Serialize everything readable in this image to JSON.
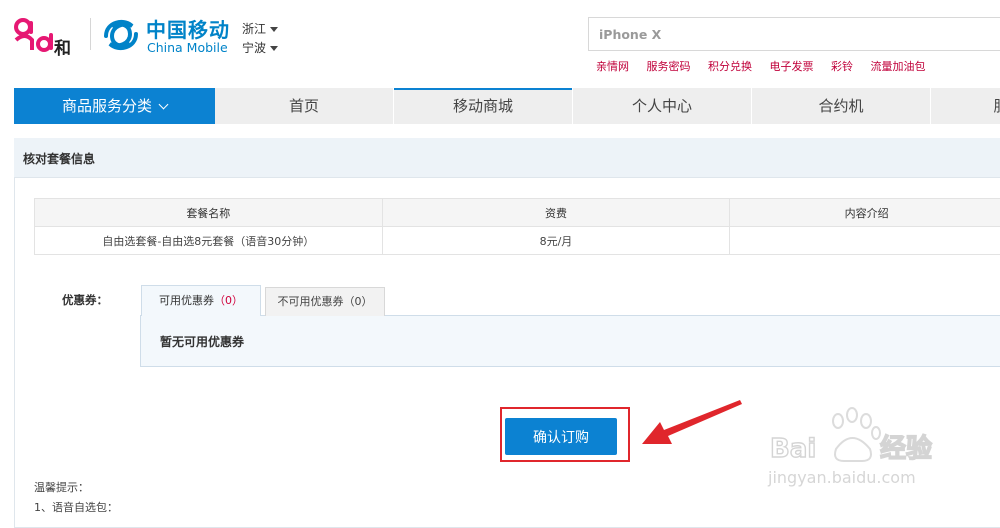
{
  "brand": {
    "logo_text": "and和",
    "he_char": "和",
    "cmcc_cn": "中国移动",
    "cmcc_en": "China Mobile"
  },
  "region": {
    "province": "浙江",
    "city": "宁波"
  },
  "search": {
    "placeholder": "iPhone X"
  },
  "quick_links": [
    "亲情网",
    "服务密码",
    "积分兑换",
    "电子发票",
    "彩铃",
    "流量加油包"
  ],
  "nav": {
    "items": [
      "商品服务分类",
      "首页",
      "移动商城",
      "个人中心",
      "合约机",
      "服"
    ],
    "active_index": 2
  },
  "panel": {
    "title": "核对套餐信息"
  },
  "table": {
    "headers": [
      "套餐名称",
      "资费",
      "内容介绍"
    ],
    "rows": [
      [
        "自由选套餐-自由选8元套餐（语音30分钟）",
        "8元/月",
        ""
      ]
    ]
  },
  "coupon": {
    "label": "优惠券：",
    "tab_available_label": "可用优惠券",
    "tab_available_count": "（0）",
    "tab_unavailable": "不可用优惠券（0）",
    "empty_text": "暂无可用优惠券"
  },
  "confirm_button": "确认订购",
  "tips": {
    "title": "温馨提示：",
    "line1": "1、语音自选包："
  },
  "watermark": {
    "text": "jingyan.baidu.com"
  },
  "colors": {
    "accent": "#0c82d2",
    "brand_red": "#c0003a",
    "highlight_red": "#e0262c"
  }
}
